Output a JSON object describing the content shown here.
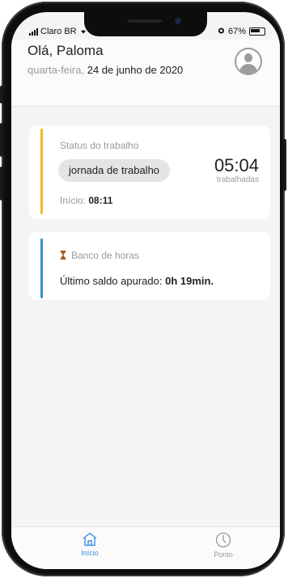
{
  "status_bar": {
    "carrier": "Claro BR",
    "battery": "67%"
  },
  "header": {
    "greeting": "Olá, Paloma",
    "weekday": "quarta-feira,",
    "date": "24 de junho de 2020"
  },
  "work_status": {
    "title": "Status do trabalho",
    "status": "jornada de trabalho",
    "start_label": "Início:",
    "start_time": "08:11",
    "worked_time": "05:04",
    "worked_label": "trabalhadas"
  },
  "hour_bank": {
    "title": "Banco de horas",
    "balance_label": "Último saldo apurado:",
    "balance_value": "0h 19min."
  },
  "tabbar": {
    "tabs": [
      {
        "label": "Início",
        "icon": "home-icon",
        "active": true
      },
      {
        "label": "Ponto",
        "icon": "clock-icon",
        "active": false
      }
    ]
  },
  "colors": {
    "accent_blue": "#2d8fd9",
    "accent_yellow": "#f2b91f",
    "muted_text": "#9a9a9a"
  }
}
